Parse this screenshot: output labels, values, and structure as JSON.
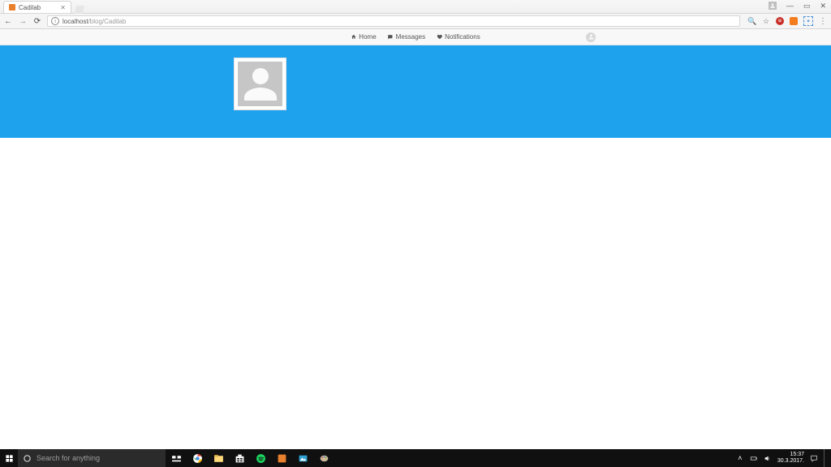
{
  "browser": {
    "tab_title": "Cadilab",
    "url_info_tooltip": "i",
    "url_host": "localhost",
    "url_path": "/blog/Cadilab",
    "toolbar": {
      "zoom_icon": "🔍",
      "star_icon": "☆",
      "menu_dots": "⋮"
    },
    "win": {
      "minimize": "—",
      "maximize": "▭",
      "close": "✕"
    }
  },
  "site": {
    "nav": {
      "home": "Home",
      "messages": "Messages",
      "notifications": "Notifications"
    }
  },
  "taskbar": {
    "search_placeholder": "Search for anything",
    "tray": {
      "chevron": "˄",
      "time": "15:37",
      "date": "30.3.2017."
    }
  }
}
